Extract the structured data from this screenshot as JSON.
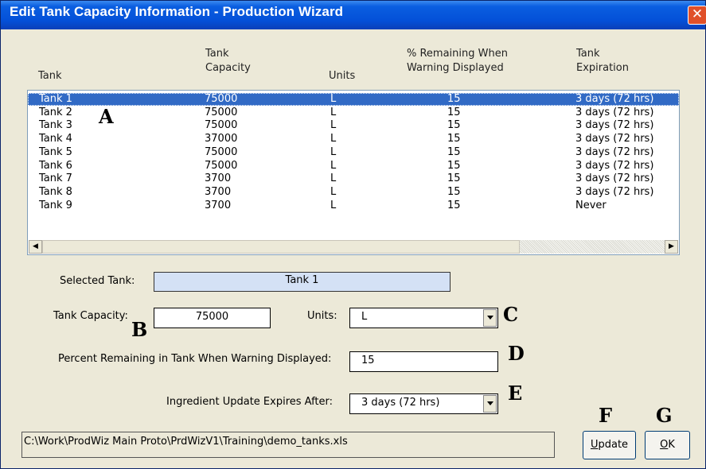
{
  "window": {
    "title": "Edit Tank Capacity Information - Production Wizard",
    "close_glyph": "✕"
  },
  "columns": {
    "tank": "Tank",
    "capacity_line1": "Tank",
    "capacity_line2": "Capacity",
    "units": "Units",
    "warning_line1": "% Remaining When",
    "warning_line2": "Warning Displayed",
    "expiration_line1": "Tank",
    "expiration_line2": "Expiration"
  },
  "tanks": [
    {
      "name": "Tank 1",
      "capacity": "75000",
      "units": "L",
      "warning": "15",
      "expiration": "3 days (72 hrs)"
    },
    {
      "name": "Tank 2",
      "capacity": "75000",
      "units": "L",
      "warning": "15",
      "expiration": "3 days (72 hrs)"
    },
    {
      "name": "Tank 3",
      "capacity": "75000",
      "units": "L",
      "warning": "15",
      "expiration": "3 days (72 hrs)"
    },
    {
      "name": "Tank 4",
      "capacity": "37000",
      "units": "L",
      "warning": "15",
      "expiration": "3 days (72 hrs)"
    },
    {
      "name": "Tank 5",
      "capacity": "75000",
      "units": "L",
      "warning": "15",
      "expiration": "3 days (72 hrs)"
    },
    {
      "name": "Tank 6",
      "capacity": "75000",
      "units": "L",
      "warning": "15",
      "expiration": "3 days (72 hrs)"
    },
    {
      "name": "Tank 7",
      "capacity": "3700",
      "units": "L",
      "warning": "15",
      "expiration": "3 days (72 hrs)"
    },
    {
      "name": "Tank 8",
      "capacity": "3700",
      "units": "L",
      "warning": "15",
      "expiration": "3 days (72 hrs)"
    },
    {
      "name": "Tank 9",
      "capacity": "3700",
      "units": "L",
      "warning": "15",
      "expiration": "Never"
    }
  ],
  "selected_row_index": 0,
  "form": {
    "selected_tank_label": "Selected Tank:",
    "selected_tank_value": "Tank 1",
    "capacity_label": "Tank Capacity:",
    "capacity_value": "75000",
    "units_label": "Units:",
    "units_value": "L",
    "warning_label": "Percent Remaining in Tank When Warning  Displayed:",
    "warning_value": "15",
    "expires_label": "Ingredient Update Expires After:",
    "expires_value": "3 days (72 hrs)"
  },
  "annotations": {
    "a": "A",
    "b": "B",
    "c": "C",
    "d": "D",
    "e": "E",
    "f": "F",
    "g": "G"
  },
  "footer": {
    "file_path": "C:\\Work\\ProdWiz Main Proto\\PrdWizV1\\Training\\demo_tanks.xls",
    "update_mnemonic": "U",
    "update_rest": "pdate",
    "ok_mnemonic": "O",
    "ok_rest": "K"
  },
  "scrollbar": {
    "left_arrow": "◀",
    "right_arrow": "▶"
  },
  "colors": {
    "titlebar": "#0450d8",
    "selection": "#316ac5",
    "dialog_bg": "#ece9d8",
    "readonly_field": "#d4e1f5"
  }
}
